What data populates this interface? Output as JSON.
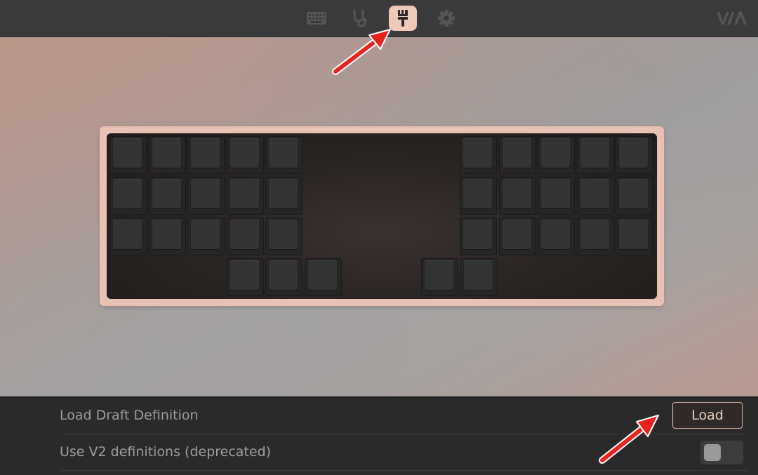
{
  "topbar": {
    "nav": [
      {
        "icon": "keyboard-icon",
        "active": false
      },
      {
        "icon": "stethoscope-icon",
        "active": false
      },
      {
        "icon": "paintbrush-icon",
        "active": true
      },
      {
        "icon": "gear-icon",
        "active": false
      }
    ],
    "logo_text": "VIA"
  },
  "keyboard": {
    "frame_color": "#e9c2b3",
    "key_count": 34
  },
  "settings": {
    "load_draft": {
      "label": "Load Draft Definition",
      "button_label": "Load"
    },
    "v2_definitions": {
      "label": "Use V2 definitions (deprecated)",
      "toggle_on": false
    }
  },
  "colors": {
    "accent": "#f0c8b8",
    "annotation": "#e8231f"
  }
}
